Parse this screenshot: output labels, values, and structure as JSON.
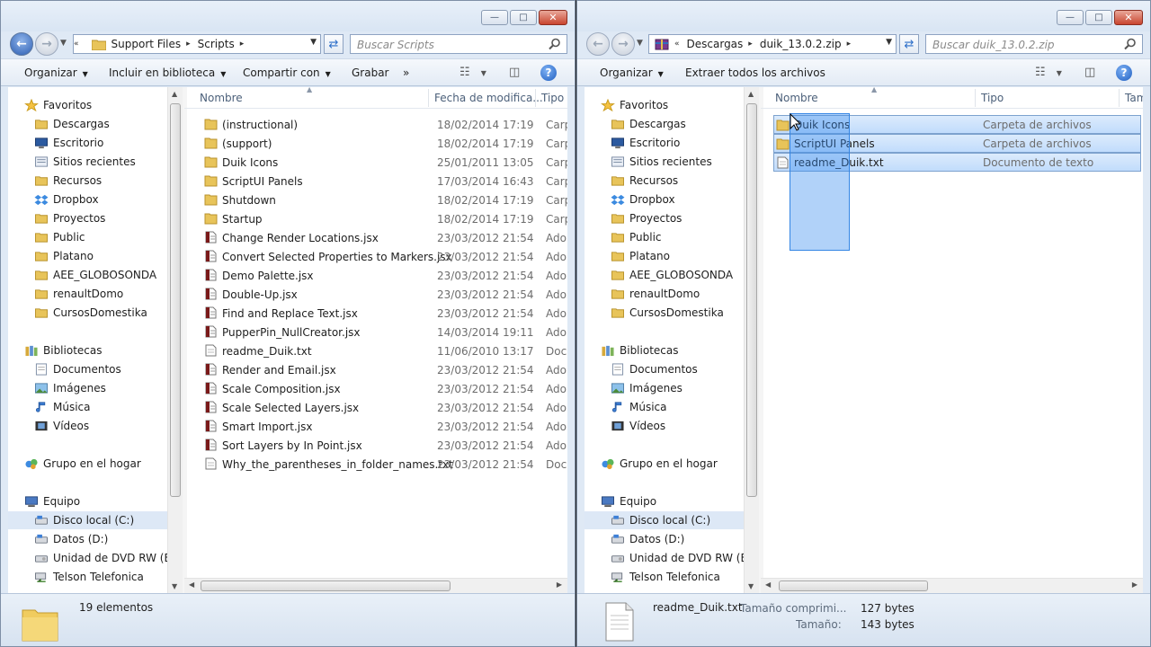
{
  "left": {
    "address": [
      "Support Files",
      "Scripts"
    ],
    "search_placeholder": "Buscar Scripts",
    "toolbar": [
      "Organizar",
      "Incluir en biblioteca",
      "Compartir con",
      "Grabar",
      "»"
    ],
    "columns": [
      "Nombre",
      "Fecha de modifica...",
      "Tipo"
    ],
    "files": [
      {
        "name": "(instructional)",
        "date": "18/02/2014 17:19",
        "type": "Carpe",
        "icon": "folder"
      },
      {
        "name": "(support)",
        "date": "18/02/2014 17:19",
        "type": "Carpe",
        "icon": "folder"
      },
      {
        "name": "Duik Icons",
        "date": "25/01/2011 13:05",
        "type": "Carpe",
        "icon": "folder"
      },
      {
        "name": "ScriptUI Panels",
        "date": "17/03/2014 16:43",
        "type": "Carpe",
        "icon": "folder"
      },
      {
        "name": "Shutdown",
        "date": "18/02/2014 17:19",
        "type": "Carpe",
        "icon": "folder"
      },
      {
        "name": "Startup",
        "date": "18/02/2014 17:19",
        "type": "Carpe",
        "icon": "folder"
      },
      {
        "name": "Change Render Locations.jsx",
        "date": "23/03/2012 21:54",
        "type": "Adob",
        "icon": "jsx"
      },
      {
        "name": "Convert Selected Properties to Markers.jsx",
        "date": "23/03/2012 21:54",
        "type": "Adob",
        "icon": "jsx"
      },
      {
        "name": "Demo Palette.jsx",
        "date": "23/03/2012 21:54",
        "type": "Adob",
        "icon": "jsx"
      },
      {
        "name": "Double-Up.jsx",
        "date": "23/03/2012 21:54",
        "type": "Adob",
        "icon": "jsx"
      },
      {
        "name": "Find and Replace Text.jsx",
        "date": "23/03/2012 21:54",
        "type": "Adob",
        "icon": "jsx"
      },
      {
        "name": "PupperPin_NullCreator.jsx",
        "date": "14/03/2014 19:11",
        "type": "Adob",
        "icon": "jsx"
      },
      {
        "name": "readme_Duik.txt",
        "date": "11/06/2010 13:17",
        "type": "Docu",
        "icon": "txt"
      },
      {
        "name": "Render and Email.jsx",
        "date": "23/03/2012 21:54",
        "type": "Adob",
        "icon": "jsx"
      },
      {
        "name": "Scale Composition.jsx",
        "date": "23/03/2012 21:54",
        "type": "Adob",
        "icon": "jsx"
      },
      {
        "name": "Scale Selected Layers.jsx",
        "date": "23/03/2012 21:54",
        "type": "Adob",
        "icon": "jsx"
      },
      {
        "name": "Smart Import.jsx",
        "date": "23/03/2012 21:54",
        "type": "Adob",
        "icon": "jsx"
      },
      {
        "name": "Sort Layers by In Point.jsx",
        "date": "23/03/2012 21:54",
        "type": "Adob",
        "icon": "jsx"
      },
      {
        "name": "Why_the_parentheses_in_folder_names.txt",
        "date": "23/03/2012 21:54",
        "type": "Docu",
        "icon": "txt"
      }
    ],
    "details": {
      "count": "19 elementos"
    }
  },
  "right": {
    "address": [
      "Descargas",
      "duik_13.0.2.zip"
    ],
    "search_placeholder": "Buscar duik_13.0.2.zip",
    "toolbar": [
      "Organizar",
      "Extraer todos los archivos"
    ],
    "columns": [
      "Nombre",
      "Tipo",
      "Tam"
    ],
    "files": [
      {
        "name": "Duik Icons",
        "type": "Carpeta de archivos",
        "icon": "folder"
      },
      {
        "name": "ScriptUI Panels",
        "type": "Carpeta de archivos",
        "icon": "folder"
      },
      {
        "name": "readme_Duik.txt",
        "type": "Documento de texto",
        "icon": "txt"
      }
    ],
    "details": {
      "name": "readme_Duik.txt",
      "compressed_label": "Tamaño comprimi...",
      "compressed_value": "127 bytes",
      "size_label": "Tamaño:",
      "size_value": "143 bytes"
    }
  },
  "nav": [
    {
      "label": "Favoritos",
      "icon": "star-icon",
      "level": 0
    },
    {
      "label": "Descargas",
      "icon": "folder-icon",
      "level": 1
    },
    {
      "label": "Escritorio",
      "icon": "desktop-icon",
      "level": 1
    },
    {
      "label": "Sitios recientes",
      "icon": "recent-icon",
      "level": 1
    },
    {
      "label": "Recursos",
      "icon": "folder-icon",
      "level": 1
    },
    {
      "label": "Dropbox",
      "icon": "dropbox-icon",
      "level": 1
    },
    {
      "label": "Proyectos",
      "icon": "folder-icon",
      "level": 1
    },
    {
      "label": "Public",
      "icon": "folder-icon",
      "level": 1
    },
    {
      "label": "Platano",
      "icon": "folder-icon",
      "level": 1
    },
    {
      "label": "AEE_GLOBOSONDA",
      "icon": "folder-icon",
      "level": 1
    },
    {
      "label": "renaultDomo",
      "icon": "folder-icon",
      "level": 1
    },
    {
      "label": "CursosDomestika",
      "icon": "folder-icon",
      "level": 1
    },
    {
      "label": "",
      "icon": "",
      "level": -1
    },
    {
      "label": "Bibliotecas",
      "icon": "library-icon",
      "level": 0
    },
    {
      "label": "Documentos",
      "icon": "documents-icon",
      "level": 1
    },
    {
      "label": "Imágenes",
      "icon": "pictures-icon",
      "level": 1
    },
    {
      "label": "Música",
      "icon": "music-icon",
      "level": 1
    },
    {
      "label": "Vídeos",
      "icon": "videos-icon",
      "level": 1
    },
    {
      "label": "",
      "icon": "",
      "level": -1
    },
    {
      "label": "Grupo en el hogar",
      "icon": "homegroup-icon",
      "level": 0
    },
    {
      "label": "",
      "icon": "",
      "level": -1
    },
    {
      "label": "Equipo",
      "icon": "computer-icon",
      "level": 0
    },
    {
      "label": "Disco local (C:)",
      "icon": "drive-icon",
      "level": 1,
      "selected": true
    },
    {
      "label": "Datos (D:)",
      "icon": "drive-icon",
      "level": 1
    },
    {
      "label": "Unidad de DVD RW (E:) '",
      "icon": "dvd-icon",
      "level": 1
    },
    {
      "label": "Telson Telefonica",
      "icon": "network-drive-icon",
      "level": 1
    }
  ],
  "colors": {
    "selection": "#c1dcfc",
    "accent": "#2d5fb3",
    "marquee": "#3388ee"
  }
}
